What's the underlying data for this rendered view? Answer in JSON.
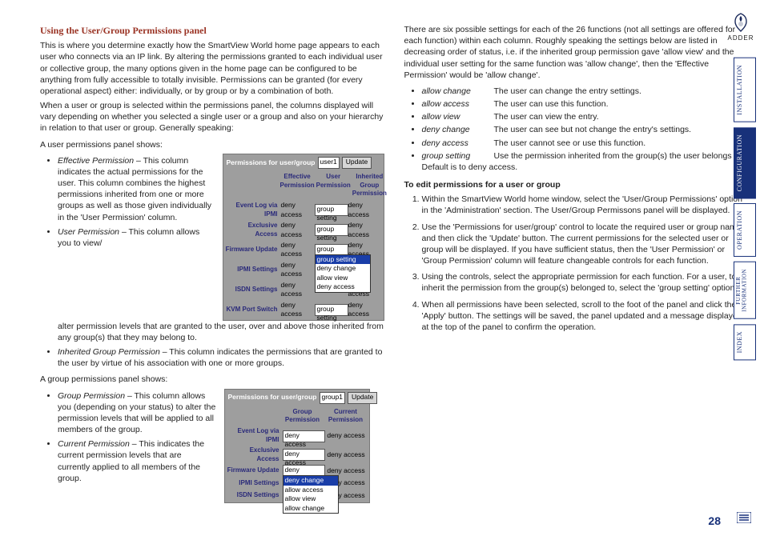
{
  "logo_text": "ADDER",
  "page_number": "28",
  "side_tabs": {
    "installation": "INSTALLATION",
    "configuration": "CONFIGURATION",
    "operation": "OPERATION",
    "further": "FURTHER\nINFORMATION",
    "index": "INDEX"
  },
  "left": {
    "title": "Using the User/Group Permissions panel",
    "p1": "This is where you determine exactly how the SmartView World home page appears to each user who connects via an IP link. By altering the permissions granted to each individual user or collective group, the many options given in the home page can be configured to be anything from fully accessible to totally invisible. Permissions can be granted (for every operational aspect) either: individually, or by group or by a combination of both.",
    "p2": "When a user or group is selected within the permissions panel, the columns displayed will vary depending on whether you selected a single user or a group and also on your hierarchy in relation to that user or group. Generally speaking:",
    "user_panel_label": "A user permissions panel shows:",
    "user_items": {
      "eff_term": "Effective Permission",
      "eff_desc": " – This column indicates the actual permissions for the user. This column combines the highest permissions inherited from one or more groups as well as those given individually in the 'User Permission' column.",
      "usr_term": "User Permission",
      "usr_desc_a": " – This column allows you to view/",
      "usr_desc_b": "alter permission levels that are granted to the user, over and above those inherited from any group(s) that they may belong to.",
      "inh_term": "Inherited Group Permission",
      "inh_desc": " – This column indicates the permissions that are granted to the user by virtue of his association with one or more groups."
    },
    "group_panel_label": "A group permissions panel shows:",
    "group_items": {
      "grp_term": "Group Permission",
      "grp_desc": " – This column allows you (depending on your status) to alter the permission levels that will be applied to all members of the group.",
      "cur_term": "Current Permission",
      "cur_desc": " – This indicates the current permission levels that are currently applied to all members of the group."
    },
    "panel1": {
      "header_label": "Permissions for user/group",
      "select_value": "user1",
      "update": "Update",
      "col1": "Effective Permission",
      "col2": "User Permission",
      "col3": "Inherited Group Permission",
      "rows": {
        "r1": "Event Log via IPMI",
        "r2": "Exclusive Access",
        "r3": "Firmware Update",
        "r4": "IPMI Settings",
        "r5": "ISDN Settings",
        "r6": "KVM Port Switch"
      },
      "deny": "deny access",
      "group_setting": "group setting",
      "menu": {
        "o1": "group setting",
        "o2": "deny change",
        "o3": "allow view",
        "o4": "deny access"
      }
    },
    "panel2": {
      "header_label": "Permissions for user/group",
      "select_value": "group1",
      "update": "Update",
      "col1": "Group Permission",
      "col2": "Current Permission",
      "rows": {
        "r1": "Event Log via IPMI",
        "r2": "Exclusive Access",
        "r3": "Firmware Update",
        "r4": "IPMI Settings",
        "r5": "ISDN Settings"
      },
      "deny": "deny access",
      "menu": {
        "o1": "deny change",
        "o2": "allow access",
        "o3": "allow view",
        "o4": "allow change"
      }
    }
  },
  "right": {
    "intro": "There are six possible settings for each of the 26 functions (not all settings are offered for each function) within each column. Roughly speaking the settings below are listed in decreasing order of status, i.e. if the inherited group permission gave 'allow view' and the individual user setting for the same function was 'allow change', then the 'Effective Permission' would be 'allow change'.",
    "settings": {
      "s1_term": "allow change",
      "s1_desc": "The user can change the entry settings.",
      "s2_term": "allow access",
      "s2_desc": "The user can use this function.",
      "s3_term": "allow view",
      "s3_desc": "The user can view the entry.",
      "s4_term": "deny change",
      "s4_desc": "The user can see but not change the entry's settings.",
      "s5_term": "deny access",
      "s5_desc": "The user cannot see or use this function.",
      "s6_term": "group setting",
      "s6_desc": "Use the permission inherited from the group(s) the user belongs to. Default is to deny access."
    },
    "subhead": "To edit permissions for a user or group",
    "steps": {
      "st1": "Within the SmartView World home window, select the 'User/Group Permissions' option in the 'Administration' section. The User/Group Permissons panel will be displayed.",
      "st2": "Use the 'Permissions for user/group' control to locate the required user or group name and then click the 'Update' button. The current permissions for the selected user or group will be displayed. If you have sufficient status, then the 'User Permission' or 'Group Permission' column will feature changeable controls for each function.",
      "st3": "Using the controls, select the appropriate permission for each function. For a user, to inherit the permission from the group(s) belonged to, select the 'group setting' option.",
      "st4": "When all permissions have been selected, scroll to the foot of the panel and click the 'Apply' button. The settings will be saved, the panel updated and a message displayed at the top of the panel to confirm the operation."
    }
  }
}
